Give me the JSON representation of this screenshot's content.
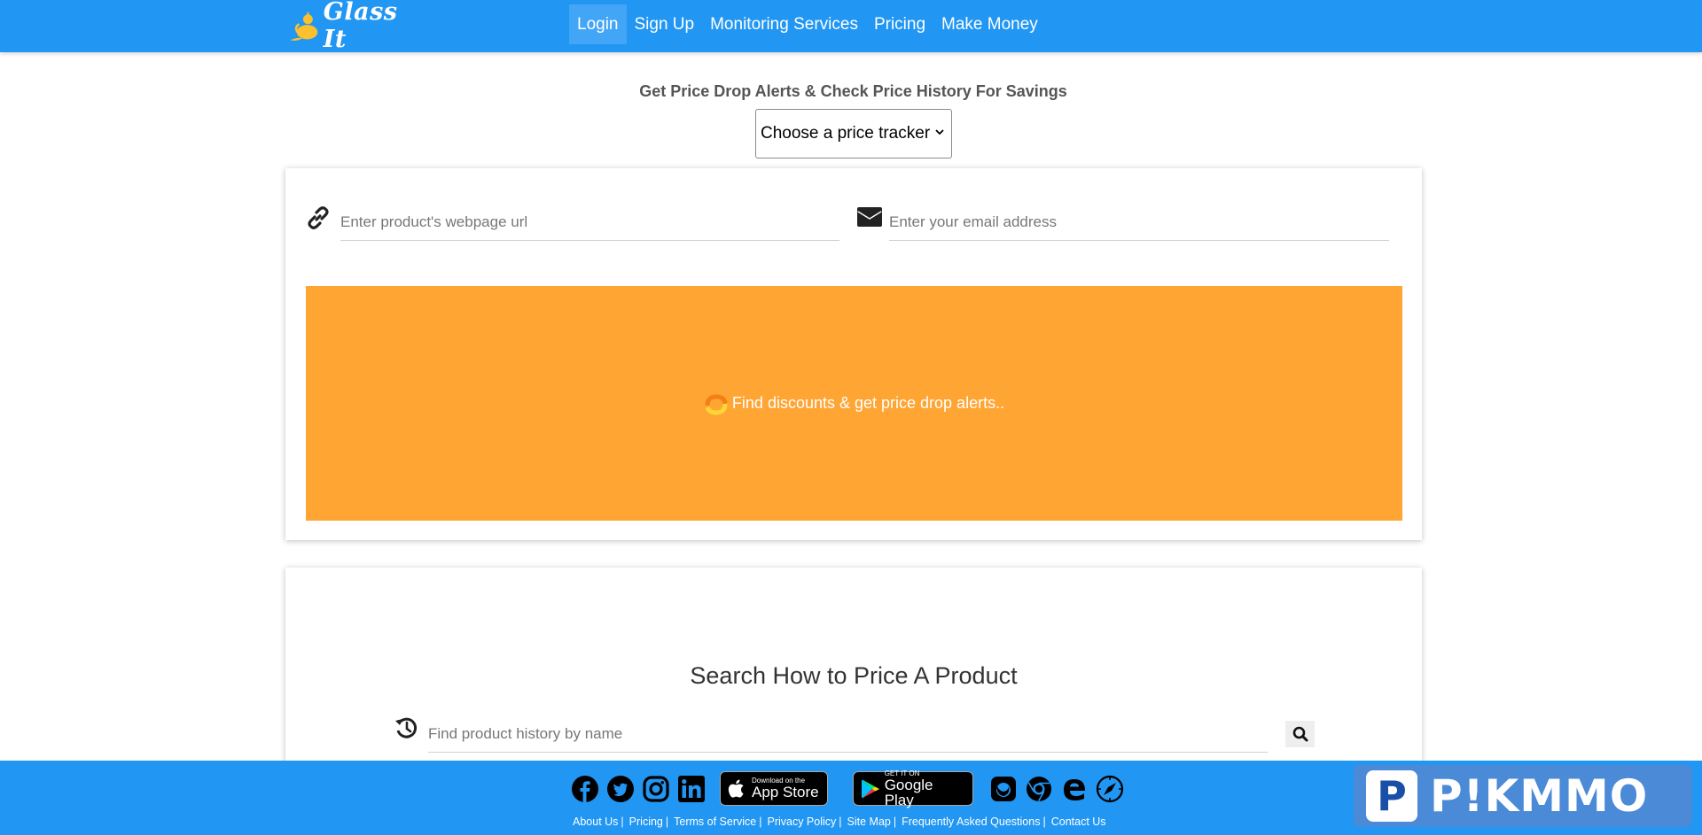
{
  "nav": {
    "logo_text": "Glass It",
    "links": [
      {
        "label": "Login",
        "active": true
      },
      {
        "label": "Sign Up"
      },
      {
        "label": "Monitoring Services"
      },
      {
        "label": "Pricing"
      },
      {
        "label": "Make Money"
      }
    ]
  },
  "header": {
    "tagline": "Get Price Drop Alerts & Check Price History For Savings",
    "tracker_select": "Choose a price tracker"
  },
  "tracker_form": {
    "url_placeholder": "Enter product's webpage url",
    "email_placeholder": "Enter your email address",
    "cta_label": "Find discounts & get price drop alerts.."
  },
  "search_section": {
    "title": "Search How to Price A Product",
    "search_placeholder": "Find product history by name"
  },
  "footer": {
    "app_store": {
      "small": "Download on the",
      "big": "App Store"
    },
    "google_play": {
      "small": "GET IT ON",
      "big": "Google Play"
    },
    "links": [
      "About Us",
      "Pricing",
      "Terms of Service",
      "Privacy Policy",
      "Site Map",
      "Frequently Asked Questions",
      "Contact Us"
    ]
  },
  "watermark": {
    "letter": "P",
    "text": "P!KMMO"
  },
  "colors": {
    "nav_blue": "#2196f3",
    "cta_orange": "#ffa534",
    "active_link": "#42a5f5"
  }
}
